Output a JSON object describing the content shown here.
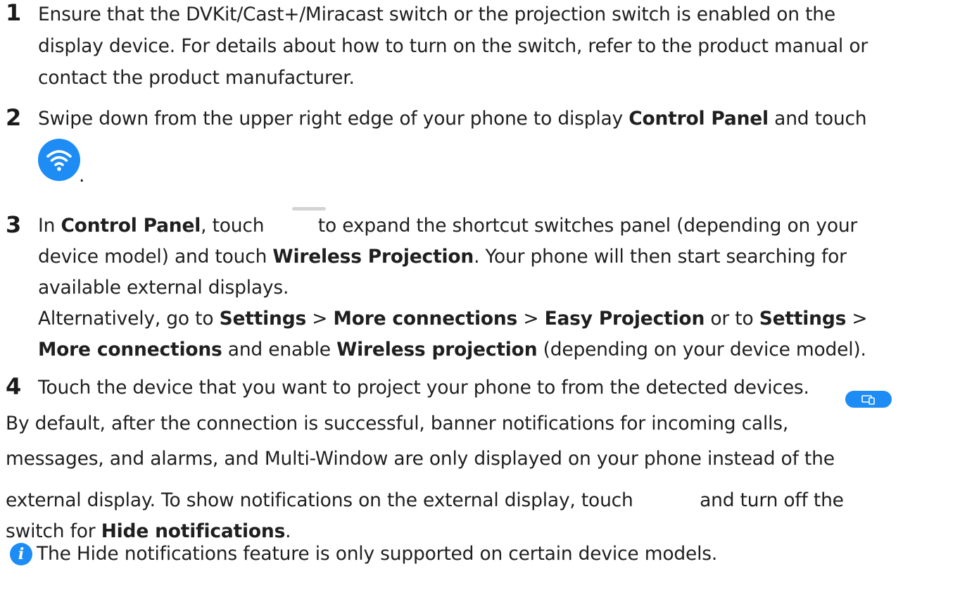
{
  "steps": [
    {
      "number": "1",
      "lines": [
        "Ensure that the DVKit/Cast+/Miracast switch or the projection switch is enabled on the",
        "display device. For details about how to turn on the switch, refer to the product manual or",
        "contact the product manufacturer."
      ]
    },
    {
      "number": "2",
      "l1_pre": "Swipe down from the upper right edge of your phone to display ",
      "l1_bold": "Control Panel",
      "l1_post": " and touch",
      "after_icon": "."
    },
    {
      "number": "3",
      "l1_a": "In ",
      "l1_b": "Control Panel",
      "l1_c": ", touch ",
      "l1_d": " to expand the shortcut switches panel (depending on your",
      "l2_a": "device model) and touch ",
      "l2_b": "Wireless Projection",
      "l2_c": ". Your phone will then start searching for",
      "l3": "available external displays.",
      "l4_a": "Alternatively, go to ",
      "l4_b": "Settings",
      "l4_c": " > ",
      "l4_d": "More connections",
      "l4_e": " > ",
      "l4_f": "Easy Projection",
      "l4_g": " or to ",
      "l4_h": "Settings",
      "l4_i": " >",
      "l5_a": "More connections",
      "l5_b": " and enable ",
      "l5_c": "Wireless projection",
      "l5_d": " (depending on your device model)."
    },
    {
      "number": "4",
      "text": "Touch the device that you want to project your phone to from the detected devices."
    }
  ],
  "paragraph": {
    "l1": "By default, after the connection is successful, banner notifications for incoming calls,",
    "l2": "messages, and alarms, and Multi-Window are only displayed on your phone instead of the",
    "l3_pre": "external display. To show notifications on the external display, touch ",
    "l3_post": " and turn off the",
    "l4_pre": "switch for ",
    "l4_bold": "Hide notifications",
    "l4_post": "."
  },
  "note": {
    "icon_glyph": "i",
    "text": "The Hide notifications feature is only supported on certain device models."
  },
  "icons": {
    "wifi": "wifi-icon",
    "handle": "panel-handle-icon",
    "projection": "projection-settings-icon",
    "info": "info-icon"
  },
  "colors": {
    "accent": "#1e8cf5",
    "text": "#1f1f1f",
    "handle": "#d4d4d4"
  }
}
